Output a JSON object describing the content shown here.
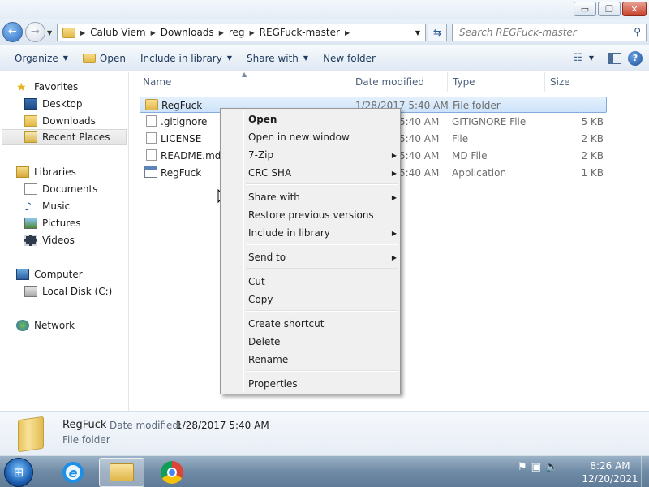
{
  "window": {
    "controls": {
      "minimize": "▭",
      "maximize": "❐",
      "close": "✕"
    }
  },
  "navigation": {
    "back_icon": "back-arrow-icon",
    "forward_icon": "forward-arrow-icon",
    "breadcrumbs": [
      "Calub Viem",
      "Downloads",
      "reg",
      "REGFuck-master"
    ],
    "search_placeholder": "Search REGFuck-master"
  },
  "toolbar": {
    "organize": "Organize",
    "open": "Open",
    "include_in_library": "Include in library",
    "share_with": "Share with",
    "new_folder": "New folder"
  },
  "sidebar": {
    "favorites": {
      "label": "Favorites",
      "items": [
        "Desktop",
        "Downloads",
        "Recent Places"
      ]
    },
    "libraries": {
      "label": "Libraries",
      "items": [
        "Documents",
        "Music",
        "Pictures",
        "Videos"
      ]
    },
    "computer": {
      "label": "Computer",
      "items": [
        "Local Disk (C:)"
      ]
    },
    "network": {
      "label": "Network"
    }
  },
  "columns": {
    "name": "Name",
    "date_modified": "Date modified",
    "type": "Type",
    "size": "Size"
  },
  "files": [
    {
      "name": "RegFuck",
      "date": "1/28/2017 5:40 AM",
      "type": "File folder",
      "size": "",
      "icon": "folder-icon"
    },
    {
      "name": ".gitignore",
      "date": "1/28/2017 5:40 AM",
      "type": "GITIGNORE File",
      "size": "5 KB",
      "icon": "file-icon"
    },
    {
      "name": "LICENSE",
      "date": "1/28/2017 5:40 AM",
      "type": "File",
      "size": "2 KB",
      "icon": "file-icon"
    },
    {
      "name": "README.md",
      "date": "1/28/2017 5:40 AM",
      "type": "MD File",
      "size": "2 KB",
      "icon": "file-icon"
    },
    {
      "name": "RegFuck",
      "date": "1/28/2017 5:40 AM",
      "type": "Application",
      "size": "1 KB",
      "icon": "application-icon"
    }
  ],
  "visible_dates": [
    "1/28/2017 5:40 AM",
    "5:40 AM",
    "5:40 AM",
    "5:40 AM",
    "5:40 AM"
  ],
  "context_menu": {
    "open": "Open",
    "open_new_window": "Open in new window",
    "seven_zip": "7-Zip",
    "crc_sha": "CRC SHA",
    "share_with": "Share with",
    "restore_previous": "Restore previous versions",
    "include_in_library": "Include in library",
    "send_to": "Send to",
    "cut": "Cut",
    "copy": "Copy",
    "create_shortcut": "Create shortcut",
    "delete": "Delete",
    "rename": "Rename",
    "properties": "Properties"
  },
  "details": {
    "name": "RegFuck",
    "date_label": "Date modified:",
    "date_value": "1/28/2017 5:40 AM",
    "type": "File folder"
  },
  "taskbar": {
    "apps": [
      "internet-explorer-icon",
      "windows-explorer-icon",
      "chrome-icon"
    ],
    "time": "8:26 AM",
    "date": "12/20/2021"
  },
  "colors": {
    "selection": "#cde3fa",
    "selection_border": "#84acdd",
    "taskbar": "#6f8aa5"
  }
}
